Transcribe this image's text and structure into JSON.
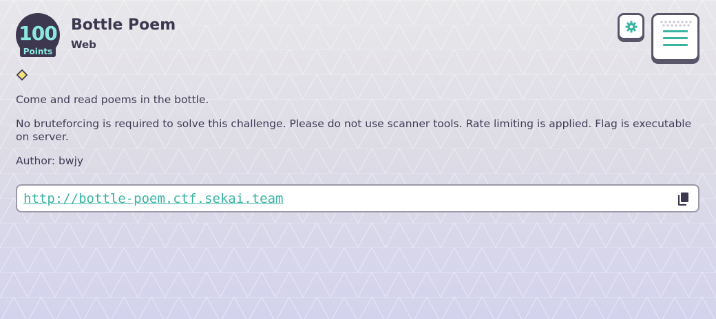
{
  "challenge": {
    "points_value": "100",
    "points_label": "Points",
    "title": "Bottle Poem",
    "category": "Web",
    "description": [
      "Come and read poems in the bottle.",
      "No bruteforcing is required to solve this challenge. Please do not use scanner tools. Rate limiting is applied. Flag is executable on server.",
      "Author: bwjy"
    ],
    "url": "http://bottle-poem.ctf.sekai.team"
  },
  "icons": {
    "difficulty": "diamond-icon",
    "copy": "copy-icon",
    "settings": "gear-icon",
    "menu": "hamburger-menu-icon"
  },
  "colors": {
    "accent": "#3bb3a2",
    "badge_bg": "#3d3850",
    "badge_text": "#8ce8e0",
    "diamond": "#f6e27a"
  }
}
